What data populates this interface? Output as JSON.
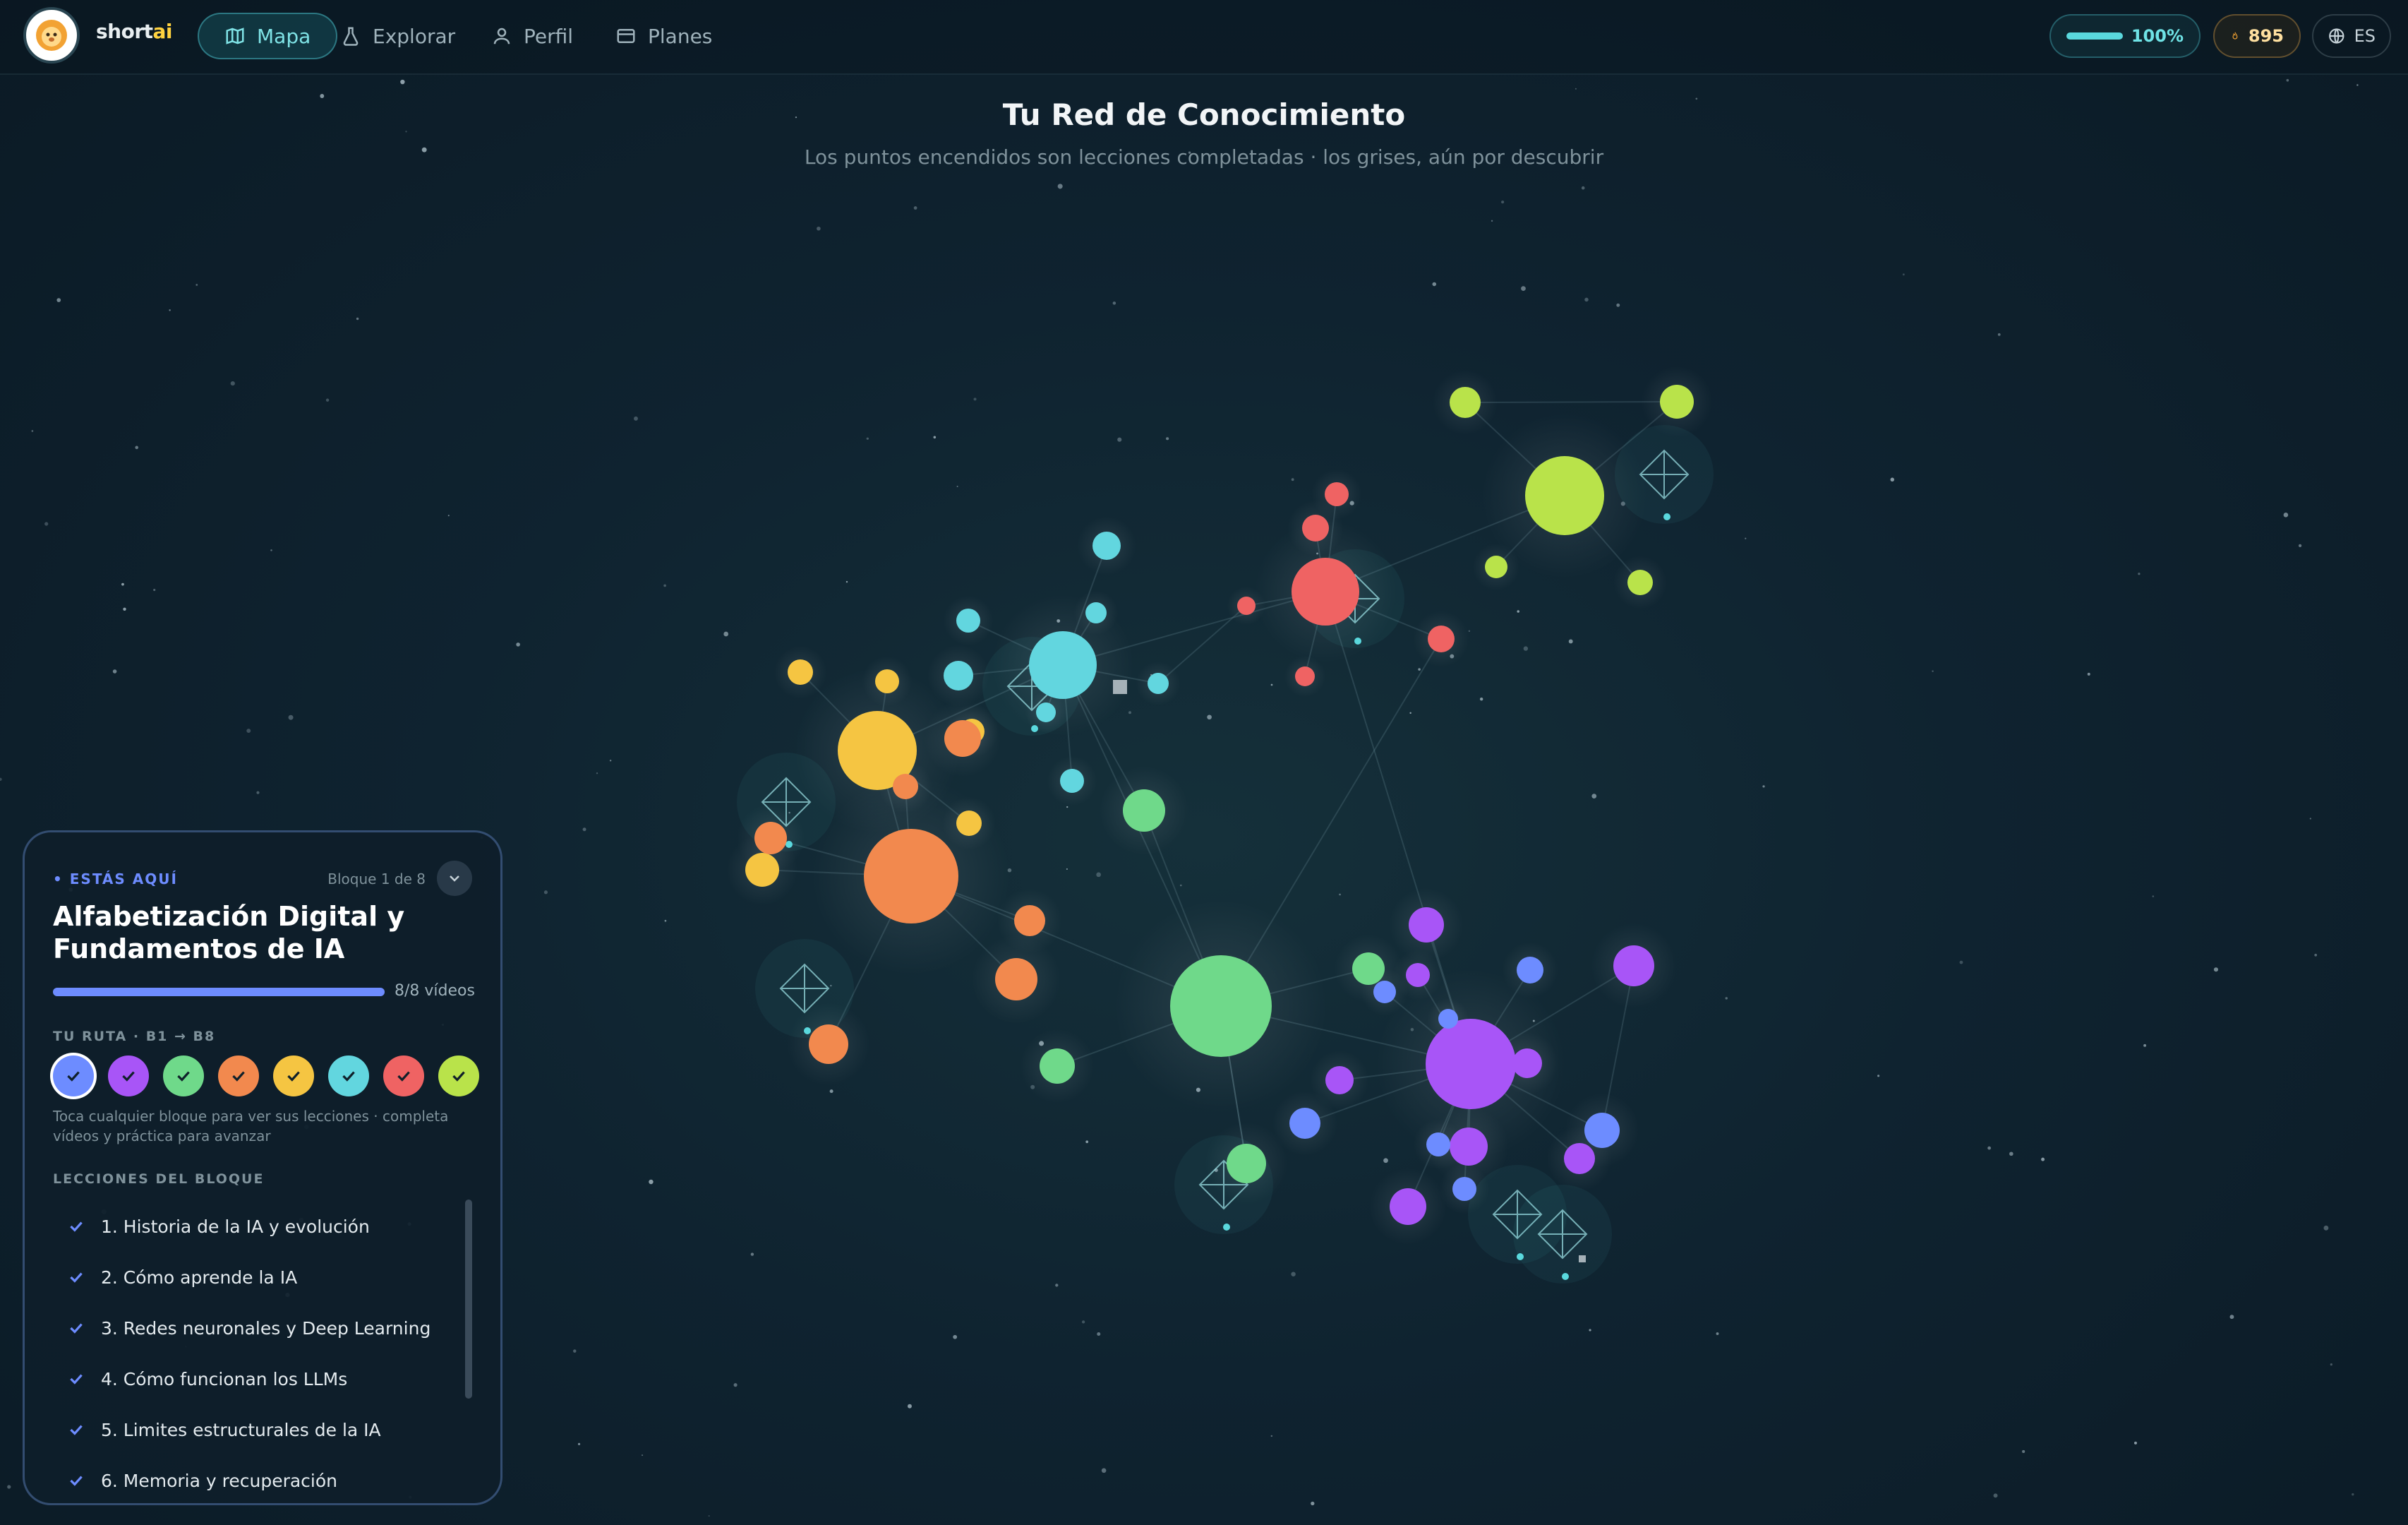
{
  "header": {
    "brand": "shortai",
    "brand_main": "short",
    "brand_accent": "ai",
    "nav": [
      {
        "label": "Mapa",
        "icon": "map-icon",
        "active": true
      },
      {
        "label": "Explorar",
        "icon": "flask-icon",
        "active": false
      },
      {
        "label": "Perfil",
        "icon": "user-icon",
        "active": false
      },
      {
        "label": "Planes",
        "icon": "card-icon",
        "active": false
      }
    ],
    "progress_value": "100%",
    "progress_fraction": 1.0,
    "streak": "895",
    "language": "ES"
  },
  "main": {
    "title": "Tu Red de Conocimiento",
    "subtitle": "Los puntos encendidos son lecciones completadas · los grises, aún por descubrir"
  },
  "panel": {
    "here_label": "• ESTÁS AQUÍ",
    "block_label": "Bloque 1 de 8",
    "block_title": "Alfabetización Digital y Fundamentos de IA",
    "progress_text": "8/8 vídeos",
    "progress_fraction": 1.0,
    "route_label": "TU RUTA · B1 → B8",
    "route_colors": [
      "#6d8cff",
      "#a855f7",
      "#6fd98a",
      "#f2894e",
      "#f5c542",
      "#62d6df",
      "#ef6363",
      "#b9e34a"
    ],
    "hint": "Toca cualquier bloque para ver sus lecciones · completa vídeos y práctica para avanzar",
    "lessons_label": "LECCIONES DEL BLOQUE",
    "lessons": [
      "1. Historia de la IA y evolución",
      "2. Cómo aprende la IA",
      "3. Redes neuronales y Deep Learning",
      "4. Cómo funcionan los LLMs",
      "5. Limites estructurales de la IA",
      "6. Memoria y recuperación"
    ]
  },
  "colors": {
    "blue": "#6d8cff",
    "purple": "#a855f7",
    "green": "#6fd98a",
    "orange": "#f2894e",
    "yellow": "#f5c542",
    "cyan": "#62d6df",
    "red": "#ef6363",
    "lime": "#b9e34a",
    "accent": "#5ad8dd"
  }
}
